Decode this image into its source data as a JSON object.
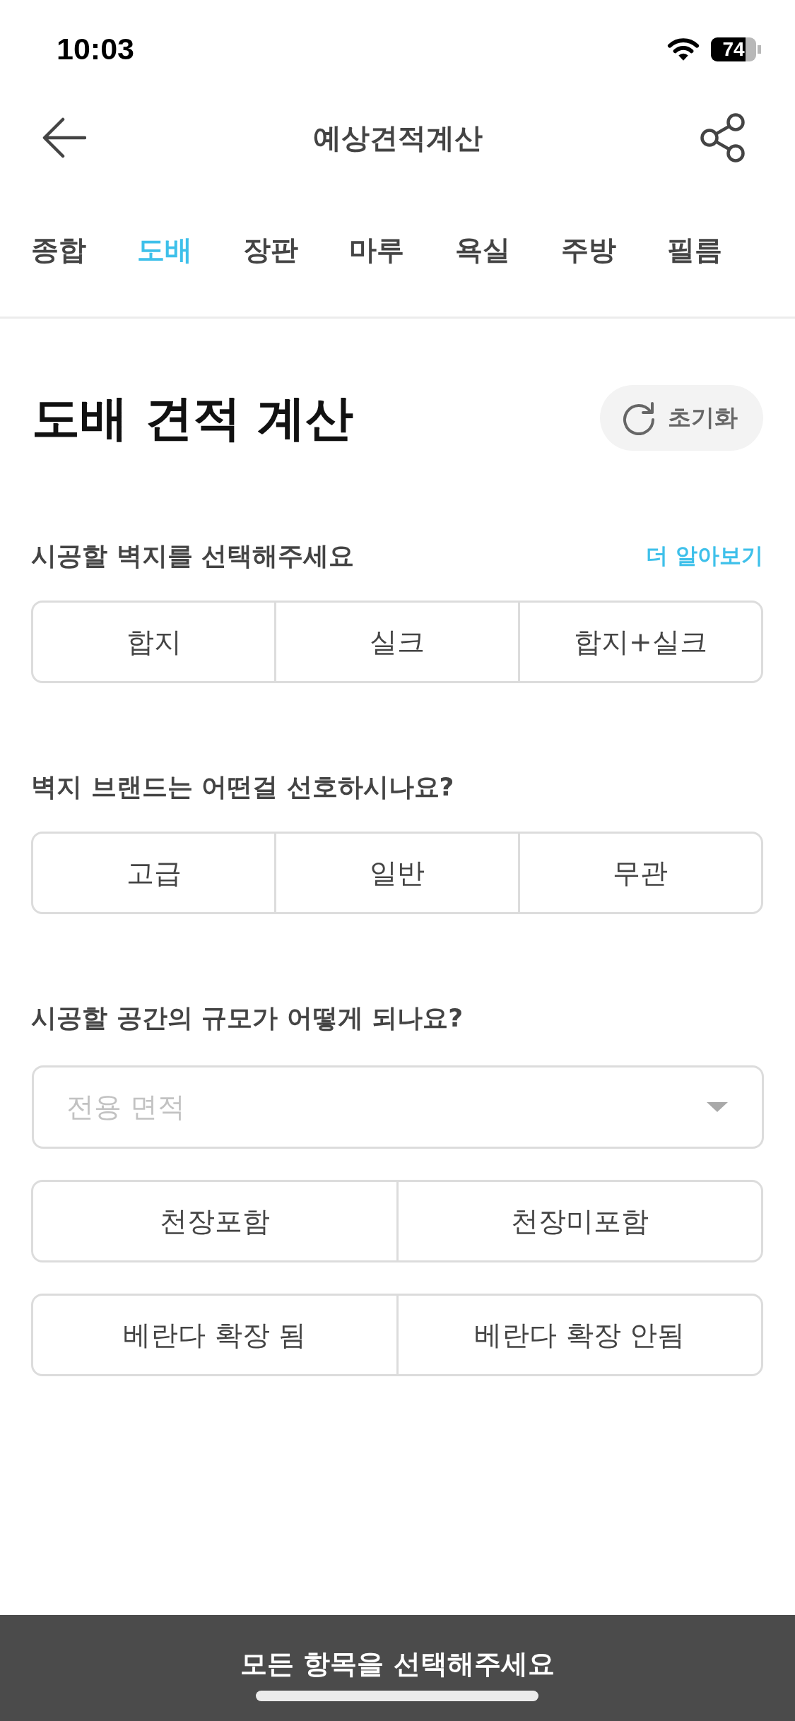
{
  "status_bar": {
    "time": "10:03",
    "battery": "74"
  },
  "header": {
    "title": "예상견적계산"
  },
  "tabs": [
    {
      "label": "종합",
      "selected": false
    },
    {
      "label": "도배",
      "selected": true
    },
    {
      "label": "장판",
      "selected": false
    },
    {
      "label": "마루",
      "selected": false
    },
    {
      "label": "욕실",
      "selected": false
    },
    {
      "label": "주방",
      "selected": false
    },
    {
      "label": "필름",
      "selected": false
    }
  ],
  "page_title": "도배 견적 계산",
  "reset_button": {
    "label": "초기화"
  },
  "questions": [
    {
      "label": "시공할 벽지를 선택해주세요",
      "link": "더 알아보기",
      "controls": [
        {
          "kind": "segments",
          "options": [
            {
              "label": "합지",
              "selected": false
            },
            {
              "label": "실크",
              "selected": false
            },
            {
              "label": "합지+실크",
              "selected": false
            }
          ]
        }
      ]
    },
    {
      "label": "벽지 브랜드는 어떤걸 선호하시나요?",
      "controls": [
        {
          "kind": "segments",
          "options": [
            {
              "label": "고급",
              "selected": false
            },
            {
              "label": "일반",
              "selected": false
            },
            {
              "label": "무관",
              "selected": false
            }
          ]
        }
      ]
    },
    {
      "label": "시공할 공간의 규모가 어떻게 되나요?",
      "controls": [
        {
          "kind": "dropdown",
          "placeholder": "전용 면적"
        },
        {
          "kind": "segments",
          "options": [
            {
              "label": "천장포함",
              "selected": false
            },
            {
              "label": "천장미포함",
              "selected": false
            }
          ]
        },
        {
          "kind": "segments",
          "options": [
            {
              "label": "베란다 확장 됨",
              "selected": false
            },
            {
              "label": "베란다 확장 안됨",
              "selected": false
            }
          ]
        }
      ]
    }
  ],
  "bottom_button": {
    "label": "모든 항목을 선택해주세요",
    "disabled": true
  }
}
